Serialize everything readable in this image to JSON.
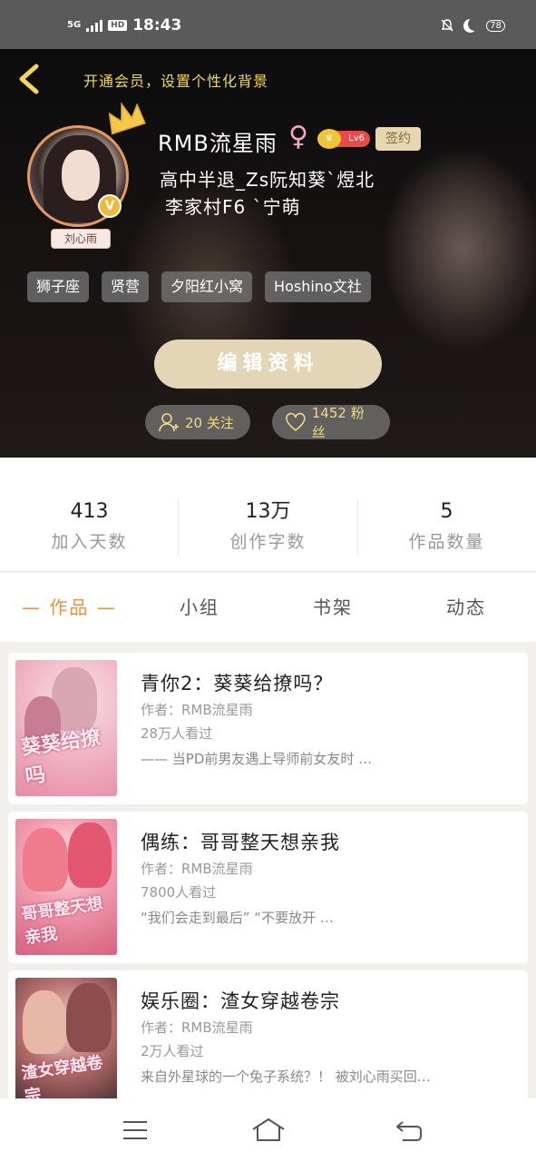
{
  "status_bar": {
    "signal": "5G",
    "hd": "HD",
    "time": "18:43",
    "battery": "78"
  },
  "header": {
    "vip_prompt": "开通会员，设置个性化背景",
    "username": "RMB流星雨",
    "gender_symbol": "♀",
    "level": "Lv6",
    "signed_badge": "签约",
    "bio_line1": "高中半退_Zs阮知葵`煜北",
    "bio_line2": "李家村F6 `宁萌",
    "avatar_tag": "刘心雨",
    "v_badge": "V",
    "tags": [
      "狮子座",
      "贤营",
      "夕阳红小窝",
      "Hoshino文社"
    ],
    "edit_button": "编辑资料",
    "follow_label": "20 关注",
    "fans_label": "1452 粉丝"
  },
  "stats": [
    {
      "value": "413",
      "label": "加入天数"
    },
    {
      "value": "13万",
      "label": "创作字数"
    },
    {
      "value": "5",
      "label": "作品数量"
    }
  ],
  "tabs": [
    {
      "label": "— 作品 —",
      "active": true
    },
    {
      "label": "小组",
      "active": false
    },
    {
      "label": "书架",
      "active": false
    },
    {
      "label": "动态",
      "active": false
    }
  ],
  "works": [
    {
      "title": "青你2：葵葵给撩吗？",
      "author": "作者：RMB流星雨",
      "views": "28万人看过",
      "desc": "—— 当PD前男友遇上导师前女友时 …",
      "cover_text": "葵葵给撩吗"
    },
    {
      "title": "偶练：哥哥整天想亲我",
      "author": "作者：RMB流星雨",
      "views": "7800人看过",
      "desc": "“我们会走到最后” “不要放开 …",
      "cover_text": "哥哥整天想亲我"
    },
    {
      "title": "娱乐圈：渣女穿越卷宗",
      "author": "作者：RMB流星雨",
      "views": "2万人看过",
      "desc": "来自外星球的一个兔子系统？！ 被刘心雨买回…",
      "cover_text": "渣女穿越卷宗"
    }
  ],
  "colors": {
    "accent_orange": "#e8924a",
    "vip_gold": "#f2d75a",
    "edit_button_bg": "#e2d6b7"
  }
}
